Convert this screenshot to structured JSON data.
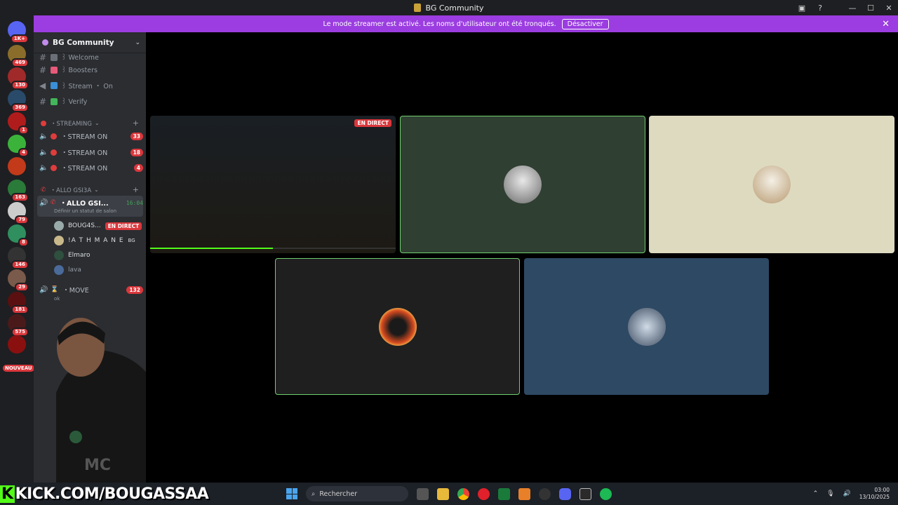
{
  "window": {
    "title": "BG Community",
    "controls": [
      "—",
      "☐",
      "✕"
    ]
  },
  "banner": {
    "text": "Le mode streamer est activé. Les noms d'utilisateur ont été tronqués.",
    "button": "Désactiver"
  },
  "servers": [
    {
      "badge": "1K+",
      "color": "#5865f2"
    },
    {
      "badge": "469",
      "color": "#8a6d2b"
    },
    {
      "badge": "130",
      "color": "#a02a2a"
    },
    {
      "badge": "369",
      "color": "#2a4a6a"
    },
    {
      "badge": "1",
      "color": "#b01c1c"
    },
    {
      "badge": "4",
      "color": "#3bb33b"
    },
    {
      "badge": "",
      "color": "#c23a1a"
    },
    {
      "badge": "163",
      "color": "#2a7a3a"
    },
    {
      "badge": "79",
      "color": "#cccccc"
    },
    {
      "badge": "8",
      "color": "#2f8f5f"
    },
    {
      "badge": "146",
      "color": "#333333"
    },
    {
      "badge": "29",
      "color": "#7a5a4a"
    },
    {
      "badge": "181",
      "color": "#5a1010"
    },
    {
      "badge": "575",
      "color": "#4a1a1a"
    },
    {
      "badge": "",
      "color": "#8a1010"
    }
  ],
  "server_new_label": "NOUVEAU",
  "guild": {
    "name": "BG Community"
  },
  "channels": {
    "top": [
      {
        "label": "꒱ Welcome",
        "icon": "welcome"
      },
      {
        "label": "꒱ Boosters",
        "icon": "rocket"
      },
      {
        "label": "꒱ Stream ・ On",
        "icon": "megaphone"
      },
      {
        "label": "꒱ Verify",
        "icon": "check"
      }
    ],
    "cat_streaming": "・STREAMING",
    "stream_channels": [
      {
        "label": "・STREAM ON",
        "count": "33"
      },
      {
        "label": "・STREAM ON",
        "count": "18"
      },
      {
        "label": "・STREAM ON",
        "count": "4"
      }
    ],
    "cat_allo": "・ALLO GSI3A",
    "active": {
      "label": "・ALLO GSI...",
      "time": "16:04",
      "status": "Définir un statut de salon"
    },
    "members": [
      {
        "name": "BOUG4S...",
        "badge": "EN DIRECT"
      },
      {
        "name": "!A T H M A N E",
        "tag": "BG"
      },
      {
        "name": "Elmaro"
      },
      {
        "name": "lava"
      }
    ],
    "move": {
      "label": "・MOVE",
      "count": "132",
      "status": "ok"
    }
  },
  "stage": {
    "live_label": "EN DIRECT"
  },
  "overlay": {
    "kick_url": "KICK.COM/BOUGASSAA"
  },
  "taskbar": {
    "search_placeholder": "Rechercher",
    "time": "03:00",
    "date": "13/10/2025"
  },
  "colors": {
    "banner": "#9b3de0",
    "live": "#da373c",
    "speaking": "#43a25a",
    "kick": "#53fc18"
  }
}
